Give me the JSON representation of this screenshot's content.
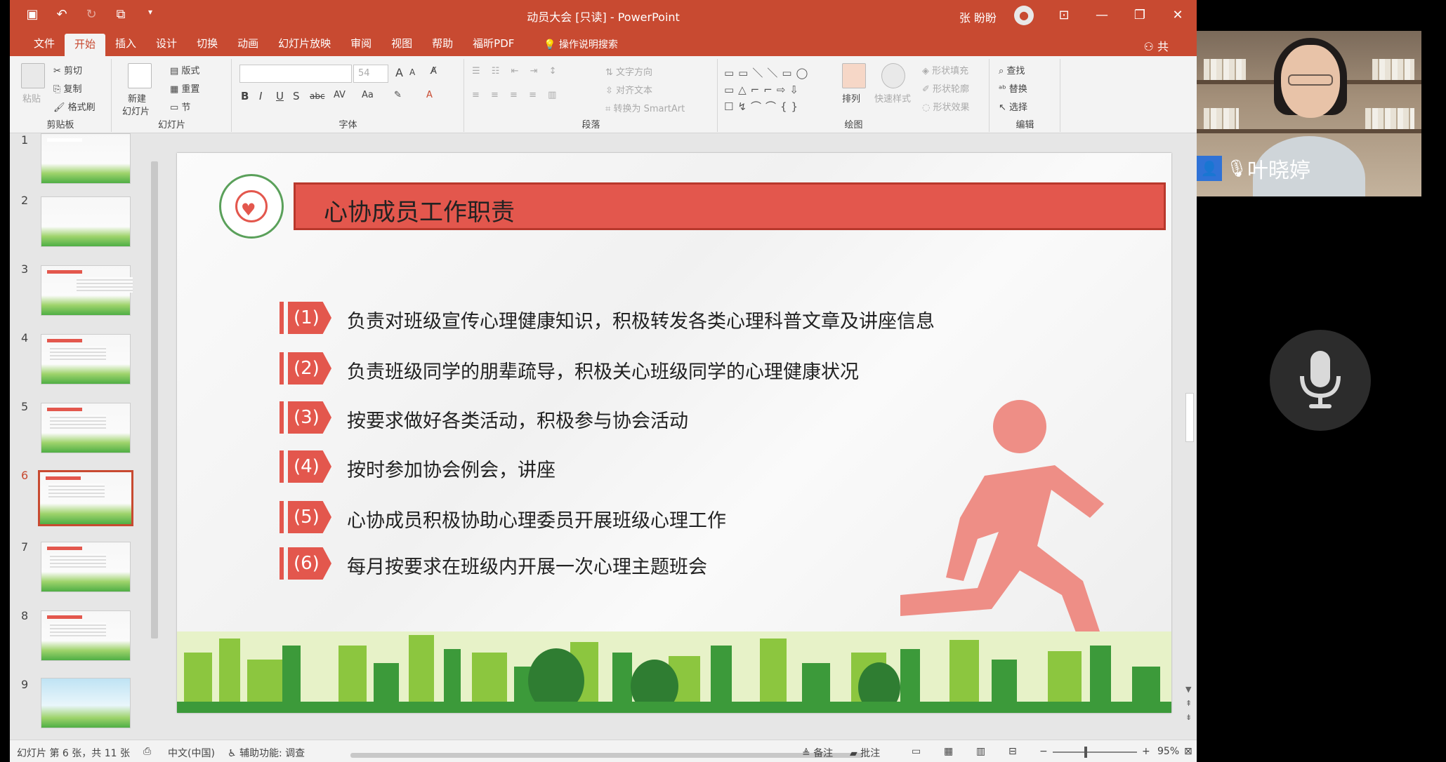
{
  "window": {
    "title": "动员大会 [只读]  -  PowerPoint",
    "user_name": "张 盼盼",
    "tell_me": "操作说明搜索",
    "share_label": "共"
  },
  "tabs": [
    {
      "label": "文件"
    },
    {
      "label": "开始"
    },
    {
      "label": "插入"
    },
    {
      "label": "设计"
    },
    {
      "label": "切换"
    },
    {
      "label": "动画"
    },
    {
      "label": "幻灯片放映"
    },
    {
      "label": "审阅"
    },
    {
      "label": "视图"
    },
    {
      "label": "帮助"
    },
    {
      "label": "福昕PDF"
    }
  ],
  "ribbon": {
    "clipboard": {
      "label": "剪贴板",
      "paste": "粘贴",
      "cut": "剪切",
      "copy": "复制",
      "format_painter": "格式刷"
    },
    "slides": {
      "label": "幻灯片",
      "new_slide_line1": "新建",
      "new_slide_line2": "幻灯片",
      "layout": "版式",
      "reset": "重置",
      "section": "节"
    },
    "font": {
      "label": "字体",
      "size_value": "54",
      "bold": "B",
      "italic": "I",
      "underline": "U",
      "strike": "S",
      "shadow": "abc",
      "spacing": "AV",
      "case": "Aa",
      "grow": "A",
      "shrink": "A"
    },
    "paragraph": {
      "label": "段落",
      "text_direction": "文字方向",
      "align_text": "对齐文本",
      "smartart": "转换为 SmartArt"
    },
    "drawing": {
      "label": "绘图",
      "arrange": "排列",
      "quick_styles": "快速样式",
      "shape_fill": "形状填充",
      "shape_outline": "形状轮廓",
      "shape_effects": "形状效果"
    },
    "editing": {
      "label": "编辑",
      "find": "查找",
      "replace": "替换",
      "select": "选择"
    }
  },
  "thumbnails": [
    {
      "num": "1"
    },
    {
      "num": "2"
    },
    {
      "num": "3"
    },
    {
      "num": "4"
    },
    {
      "num": "5"
    },
    {
      "num": "6"
    },
    {
      "num": "7"
    },
    {
      "num": "8"
    },
    {
      "num": "9"
    }
  ],
  "slide": {
    "title": "心协成员工作职责",
    "duties": [
      {
        "num": "(1)",
        "text": "负责对班级宣传心理健康知识，积极转发各类心理科普文章及讲座信息"
      },
      {
        "num": "(2)",
        "text": "负责班级同学的朋辈疏导，积极关心班级同学的心理健康状况"
      },
      {
        "num": "(3)",
        "text": "按要求做好各类活动，积极参与协会活动"
      },
      {
        "num": "(4)",
        "text": "按时参加协会例会，讲座"
      },
      {
        "num": "(5)",
        "text": "心协成员积极协助心理委员开展班级心理工作"
      },
      {
        "num": "(6)",
        "text": "每月按要求在班级内开展一次心理主题班会"
      }
    ]
  },
  "status": {
    "slide_counter": "幻灯片 第 6 张，共 11 张",
    "language": "中文(中国)",
    "accessibility": "辅助功能: 调查",
    "notes": "备注",
    "comments": "批注",
    "zoom_minus": "−",
    "zoom_plus": "+",
    "zoom": "95%"
  },
  "video": {
    "caller_name": "叶晓婷"
  },
  "colors": {
    "ppt_accent": "#c84a31",
    "slide_red": "#e3574d",
    "runner": "#ee8e86"
  }
}
